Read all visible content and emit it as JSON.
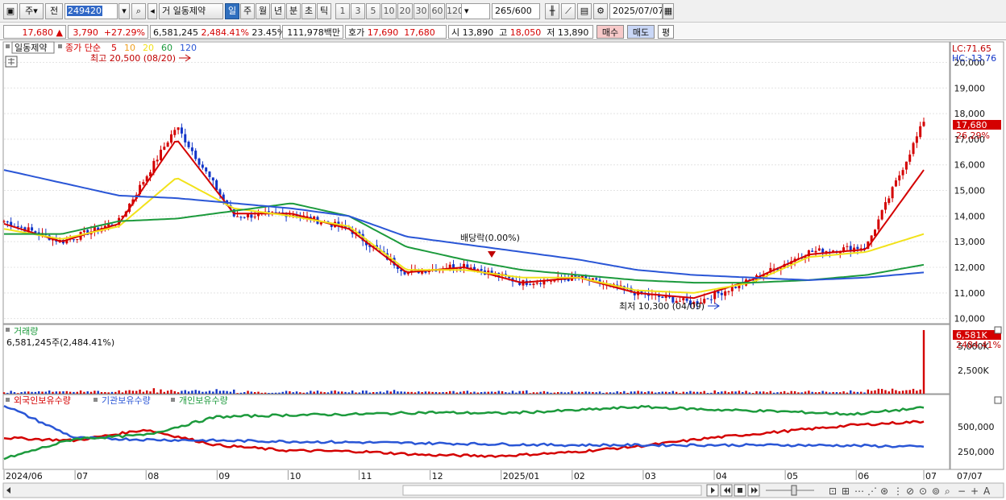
{
  "toolbar": {
    "period_label": "주",
    "prev_label": "전",
    "stock_code": "249420",
    "market_tag": "거",
    "stock_name": "일동제약",
    "period_tabs": [
      "일",
      "주",
      "월",
      "년",
      "분",
      "초",
      "틱"
    ],
    "active_tab": "일",
    "interval_buttons": [
      "1",
      "3",
      "5",
      "10",
      "20",
      "30",
      "60",
      "120"
    ],
    "count_value": "265",
    "count_total": "/600",
    "date_value": "2025/07/07"
  },
  "quote": {
    "price": "17,680",
    "change": "3,790",
    "change_pct": "+27.29%",
    "volume": "6,581,245",
    "volume_ratio": "2,484.41%",
    "turnover": "23.45%",
    "amount": "111,978백만",
    "bid_label": "호가",
    "bid_1": "17,690",
    "bid_2": "17,680",
    "open_label": "시",
    "open": "13,890",
    "high_label": "고",
    "high": "18,050",
    "low_label": "저",
    "low": "13,890",
    "buy_label": "매수",
    "sell_label": "매도",
    "eval_label": "평"
  },
  "price_panel": {
    "name_tag": "일동제약",
    "legend_prefix": "종가 단순",
    "ma_legend": [
      {
        "period": "5",
        "color": "#d40000"
      },
      {
        "period": "10",
        "color": "#f0a020"
      },
      {
        "period": "20",
        "color": "#f2e21a"
      },
      {
        "period": "60",
        "color": "#1c9a3c"
      },
      {
        "period": "120",
        "color": "#2a56d6"
      }
    ],
    "high_note": "최고 20,500 (08/20)",
    "low_note": "최저 10,300 (04/09)",
    "dividend_note": "배당락(0.00%)",
    "lc_label": "LC:71.65",
    "hc_label": "HC:-13.76",
    "current_price_tag": "17,680",
    "current_pct_tag": "26.29%"
  },
  "volume_panel": {
    "title": "거래량",
    "value_text": "6,581,245주(2,484.41%)",
    "last_tag": "6,581K",
    "last_pct_tag": "2484.41%",
    "axis_ticks": [
      "2,500K",
      "5,000K"
    ]
  },
  "holdings_panel": {
    "legend": [
      {
        "name": "외국인보유수량",
        "color": "#d40000"
      },
      {
        "name": "기관보유수량",
        "color": "#2a56d6"
      },
      {
        "name": "개인보유수량",
        "color": "#1c9a3c"
      }
    ],
    "axis_ticks": [
      "250,000",
      "500,000"
    ]
  },
  "x_axis": {
    "labels": [
      "2024/06",
      "07",
      "08",
      "09",
      "10",
      "11",
      "12",
      "2025/01",
      "02",
      "03",
      "04",
      "05",
      "06",
      "07"
    ],
    "end_label": "07/07"
  },
  "chart_data": {
    "type": "line",
    "price_axis_ticks": [
      10000,
      11000,
      12000,
      13000,
      14000,
      15000,
      16000,
      17000,
      18000,
      19000,
      20000
    ],
    "ylim": [
      9800,
      20800
    ],
    "x": [
      "2024/06",
      "07",
      "08",
      "08/20",
      "09",
      "10",
      "11",
      "12",
      "2025/01",
      "02",
      "03",
      "04",
      "04/09",
      "05",
      "06",
      "07",
      "07/07"
    ],
    "series": [
      {
        "name": "종가",
        "values": [
          13800,
          13000,
          13800,
          17500,
          14000,
          14100,
          13500,
          11800,
          12100,
          11400,
          11600,
          11000,
          10600,
          11500,
          12600,
          12800,
          17680
        ]
      },
      {
        "name": "5",
        "values": [
          13700,
          13000,
          13700,
          17000,
          14100,
          14100,
          13500,
          11800,
          12000,
          11400,
          11600,
          11000,
          10800,
          11500,
          12500,
          12700,
          15800
        ]
      },
      {
        "name": "20",
        "values": [
          13500,
          13100,
          13600,
          15500,
          14300,
          14000,
          13600,
          11900,
          11900,
          11600,
          11600,
          11100,
          11000,
          11400,
          12400,
          12600,
          13300
        ]
      },
      {
        "name": "60",
        "values": [
          13300,
          13300,
          13800,
          13900,
          14200,
          14500,
          14000,
          12800,
          12300,
          11900,
          11700,
          11500,
          11400,
          11400,
          11500,
          11700,
          12100
        ]
      },
      {
        "name": "120",
        "values": [
          15800,
          15300,
          14800,
          14700,
          14500,
          14300,
          14000,
          13200,
          12900,
          12600,
          12300,
          11900,
          11700,
          11600,
          11500,
          11600,
          11800
        ]
      }
    ],
    "volume_last": 6581245,
    "holdings_ylim": [
      0,
      700000
    ]
  }
}
